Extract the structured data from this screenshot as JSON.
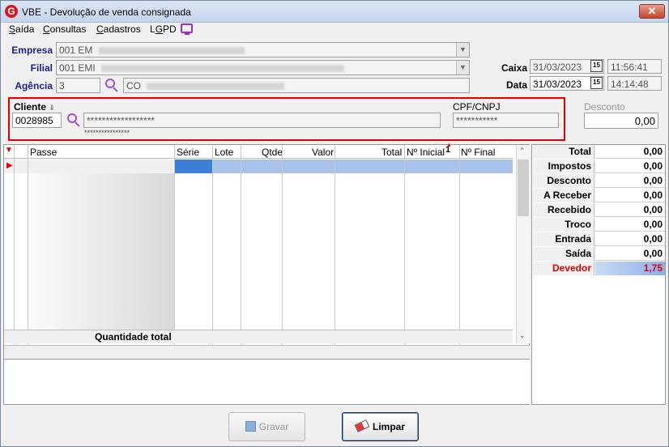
{
  "window": {
    "title": "VBE - Devolução de venda consignada",
    "app_logo": "G",
    "close_glyph": "✕"
  },
  "menu": [
    {
      "label": "Saída",
      "mnemonic_index": 0
    },
    {
      "label": "Consultas",
      "mnemonic_index": 0
    },
    {
      "label": "Cadastros",
      "mnemonic_index": 0
    },
    {
      "label": "LGPD",
      "mnemonic_index": 1
    }
  ],
  "form": {
    "empresa_label": "Empresa",
    "empresa_value": "001 EM",
    "filial_label": "Filial",
    "filial_value": "001 EMI",
    "agencia_label": "Agência",
    "agencia_code": "3",
    "agencia_name": "CO",
    "caixa_label": "Caixa",
    "caixa_date": "31/03/2023",
    "caixa_time": "11:56:41",
    "data_label": "Data",
    "data_date": "31/03/2023",
    "data_time": "14:14:48",
    "calendar_glyph": "15"
  },
  "client": {
    "label": "Cliente",
    "code": "0028985",
    "name_masked": "******************",
    "sub_masked": "****************",
    "cpf_label": "CPF/CNPJ",
    "cpf_masked": "***********",
    "desconto_label": "Desconto",
    "desconto_value": "0,00"
  },
  "grid": {
    "columns": [
      "Passe",
      "Série",
      "Lote",
      "Qtde",
      "Valor",
      "Total",
      "Nº Inicial",
      "Nº Final"
    ],
    "sort_indicator": "1",
    "footer_label": "Quantidade total"
  },
  "totals": [
    {
      "label": "Total",
      "value": "0,00"
    },
    {
      "label": "Impostos",
      "value": "0,00"
    },
    {
      "label": "Desconto",
      "value": "0,00"
    },
    {
      "label": "A Receber",
      "value": "0,00"
    },
    {
      "label": "Recebido",
      "value": "0,00"
    },
    {
      "label": "Troco",
      "value": "0,00"
    },
    {
      "label": "Entrada",
      "value": "0,00"
    },
    {
      "label": "Saída",
      "value": "0,00"
    },
    {
      "label": "Devedor",
      "value": "1,75"
    }
  ],
  "buttons": {
    "gravar": "Gravar",
    "limpar": "Limpar"
  },
  "colors": {
    "accent_red": "#e00000",
    "label_blue": "#1e1e8c",
    "search_purple": "#a44ed2",
    "selection_blue": "#3b7fd9"
  }
}
